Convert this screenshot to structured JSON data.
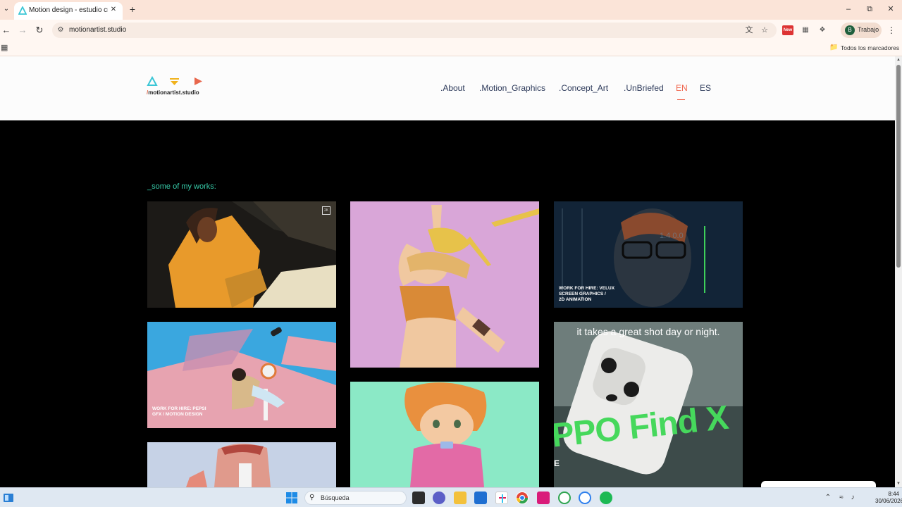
{
  "browser": {
    "tab_title": "Motion design - estudio creativo",
    "url": "motionartist.studio",
    "profile_initial": "B",
    "profile_label": "Trabajo",
    "new_badge": "New",
    "bookmarks_label": "Todos los marcadores"
  },
  "site": {
    "logo_slash": "/",
    "logo_text": "motionartist.studio",
    "nav": [
      {
        "label": ".About"
      },
      {
        "label": ".Motion_Graphics"
      },
      {
        "label": ".Concept_Art"
      },
      {
        "label": ".UnBriefed"
      },
      {
        "label": "EN"
      },
      {
        "label": "ES"
      }
    ],
    "active_language": "EN",
    "works_title": "_some of my works:",
    "works": [
      {
        "label": "",
        "badge": "2K"
      },
      {
        "label": ""
      },
      {
        "label": "WORK FOR HIRE: VELUX\nSCREEN GRAPHICS /\n2D ANIMATION"
      },
      {
        "label": "WORK FOR HIRE: PEPSI\nGFX / MOTION DESIGN"
      },
      {
        "label": "it takes a great shot day or night.",
        "brand": "PPO Find X",
        "side_letter": "E"
      },
      {
        "label": ""
      },
      {
        "label": ""
      }
    ]
  },
  "taskbar": {
    "search_label": "Búsqueda",
    "time": "8:44",
    "date": "30/06/2026"
  },
  "colors": {
    "accent_teal": "#37cba9",
    "accent_coral": "#f0644c",
    "nav_text": "#2d3a5a"
  }
}
